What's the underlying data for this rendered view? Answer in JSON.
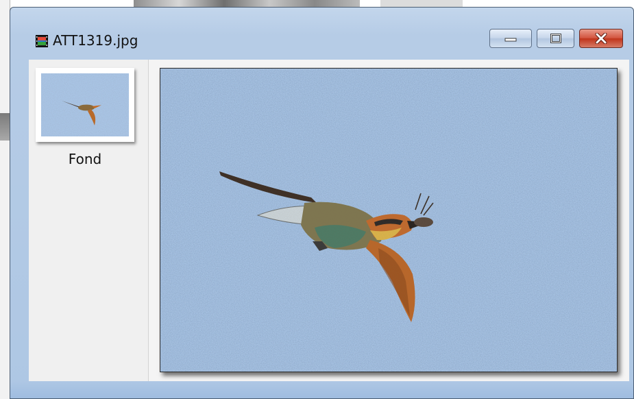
{
  "window": {
    "title": "ATT1319.jpg",
    "icon": "film-strip-icon",
    "controls": {
      "minimize": "minimize-icon",
      "maximize": "maximize-icon",
      "close": "close-icon"
    }
  },
  "thumbnails": [
    {
      "label": "Fond"
    }
  ],
  "colors": {
    "sky": "#a7c3e4",
    "frame": "#b7cce7",
    "close": "#c8402a"
  }
}
